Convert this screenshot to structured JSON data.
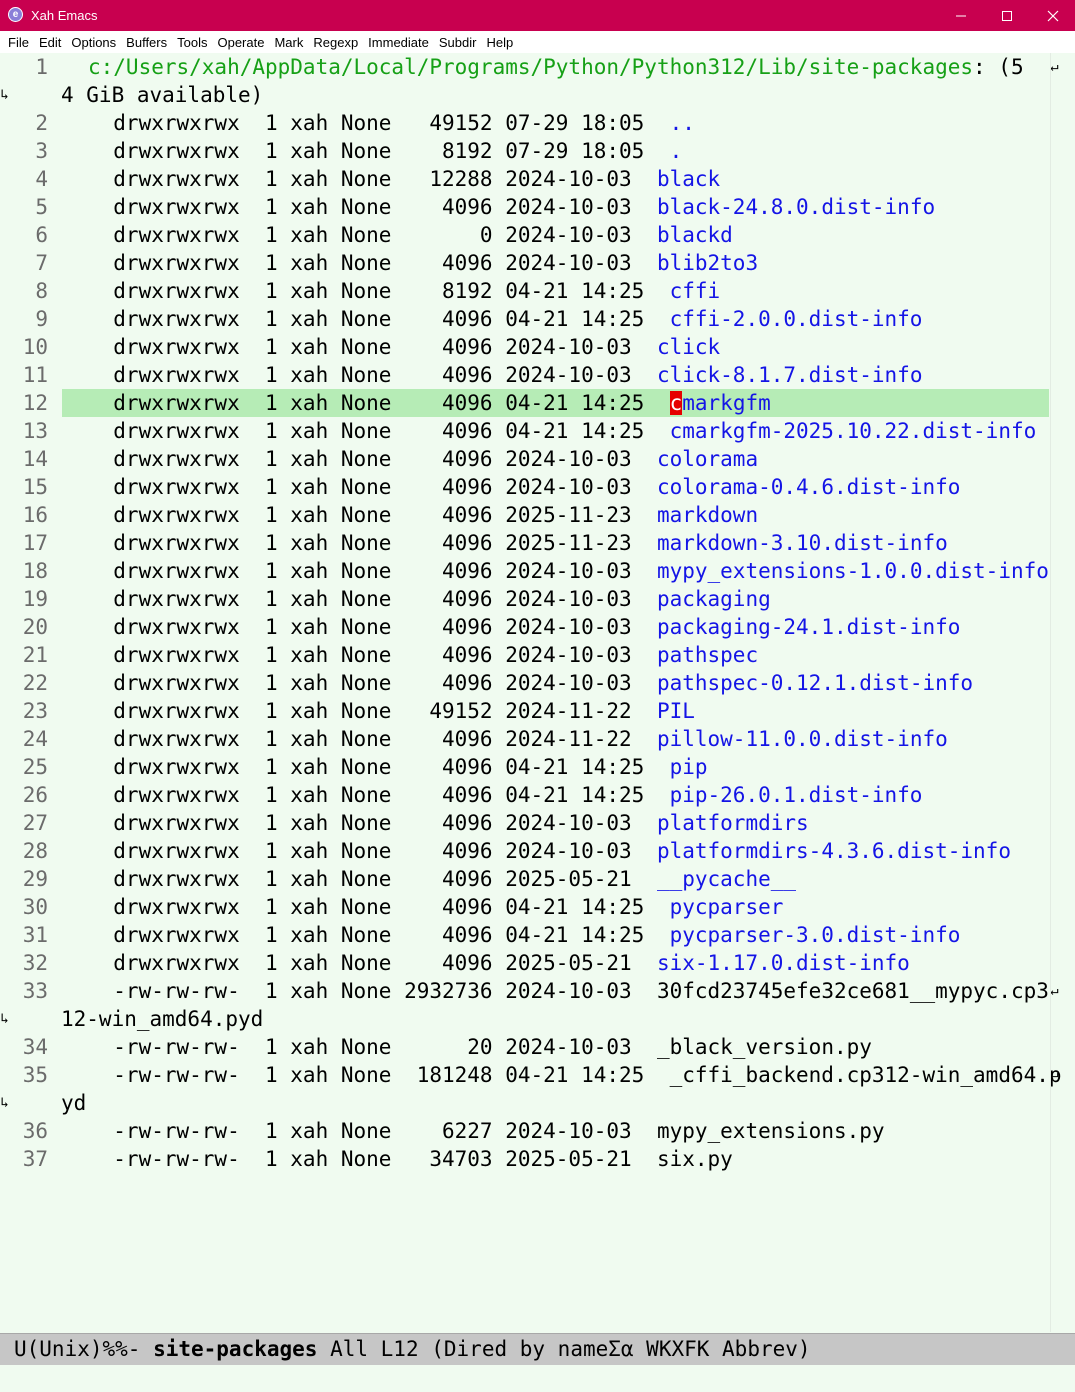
{
  "window": {
    "title": "Xah Emacs",
    "icon": "emacs-icon"
  },
  "menubar": {
    "items": [
      "File",
      "Edit",
      "Options",
      "Buffers",
      "Tools",
      "Operate",
      "Mark",
      "Regexp",
      "Immediate",
      "Subdir",
      "Help"
    ]
  },
  "colors": {
    "titlebar": "#c8004f",
    "directory": "#1414e6",
    "header_path": "#16a016",
    "highlight": "#b6ecb6",
    "cursor": "#e60000",
    "background": "#f0fbf0"
  },
  "buffer": {
    "header": {
      "line_number": "1",
      "path": "c:/Users/xah/AppData/Local/Programs/Python/Python312/Lib/site-packages",
      "rest": ": (5",
      "continuation": "4 GiB available)"
    },
    "entries": [
      {
        "n": "2",
        "attrs": "  drwxrwxrwx  1 xah None   49152 07-29 18:05  ",
        "name": "..",
        "dir": true
      },
      {
        "n": "3",
        "attrs": "  drwxrwxrwx  1 xah None    8192 07-29 18:05  ",
        "name": ".",
        "dir": true
      },
      {
        "n": "4",
        "attrs": "  drwxrwxrwx  1 xah None   12288 2024-10-03  ",
        "name": "black",
        "dir": true
      },
      {
        "n": "5",
        "attrs": "  drwxrwxrwx  1 xah None    4096 2024-10-03  ",
        "name": "black-24.8.0.dist-info",
        "dir": true
      },
      {
        "n": "6",
        "attrs": "  drwxrwxrwx  1 xah None       0 2024-10-03  ",
        "name": "blackd",
        "dir": true
      },
      {
        "n": "7",
        "attrs": "  drwxrwxrwx  1 xah None    4096 2024-10-03  ",
        "name": "blib2to3",
        "dir": true
      },
      {
        "n": "8",
        "attrs": "  drwxrwxrwx  1 xah None    8192 04-21 14:25  ",
        "name": "cffi",
        "dir": true
      },
      {
        "n": "9",
        "attrs": "  drwxrwxrwx  1 xah None    4096 04-21 14:25  ",
        "name": "cffi-2.0.0.dist-info",
        "dir": true
      },
      {
        "n": "10",
        "attrs": "  drwxrwxrwx  1 xah None    4096 2024-10-03  ",
        "name": "click",
        "dir": true
      },
      {
        "n": "11",
        "attrs": "  drwxrwxrwx  1 xah None    4096 2024-10-03  ",
        "name": "click-8.1.7.dist-info",
        "dir": true
      },
      {
        "n": "12",
        "attrs": "  drwxrwxrwx  1 xah None    4096 04-21 14:25  ",
        "name": "cmarkgfm",
        "dir": true,
        "current": true,
        "cursor_char": "c",
        "name_rest": "markgfm"
      },
      {
        "n": "13",
        "attrs": "  drwxrwxrwx  1 xah None    4096 04-21 14:25  ",
        "name": "cmarkgfm-2025.10.22.dist-info",
        "dir": true
      },
      {
        "n": "14",
        "attrs": "  drwxrwxrwx  1 xah None    4096 2024-10-03  ",
        "name": "colorama",
        "dir": true
      },
      {
        "n": "15",
        "attrs": "  drwxrwxrwx  1 xah None    4096 2024-10-03  ",
        "name": "colorama-0.4.6.dist-info",
        "dir": true
      },
      {
        "n": "16",
        "attrs": "  drwxrwxrwx  1 xah None    4096 2025-11-23  ",
        "name": "markdown",
        "dir": true
      },
      {
        "n": "17",
        "attrs": "  drwxrwxrwx  1 xah None    4096 2025-11-23  ",
        "name": "markdown-3.10.dist-info",
        "dir": true
      },
      {
        "n": "18",
        "attrs": "  drwxrwxrwx  1 xah None    4096 2024-10-03  ",
        "name": "mypy_extensions-1.0.0.dist-info",
        "dir": true
      },
      {
        "n": "19",
        "attrs": "  drwxrwxrwx  1 xah None    4096 2024-10-03  ",
        "name": "packaging",
        "dir": true
      },
      {
        "n": "20",
        "attrs": "  drwxrwxrwx  1 xah None    4096 2024-10-03  ",
        "name": "packaging-24.1.dist-info",
        "dir": true
      },
      {
        "n": "21",
        "attrs": "  drwxrwxrwx  1 xah None    4096 2024-10-03  ",
        "name": "pathspec",
        "dir": true
      },
      {
        "n": "22",
        "attrs": "  drwxrwxrwx  1 xah None    4096 2024-10-03  ",
        "name": "pathspec-0.12.1.dist-info",
        "dir": true
      },
      {
        "n": "23",
        "attrs": "  drwxrwxrwx  1 xah None   49152 2024-11-22  ",
        "name": "PIL",
        "dir": true
      },
      {
        "n": "24",
        "attrs": "  drwxrwxrwx  1 xah None    4096 2024-11-22  ",
        "name": "pillow-11.0.0.dist-info",
        "dir": true
      },
      {
        "n": "25",
        "attrs": "  drwxrwxrwx  1 xah None    4096 04-21 14:25  ",
        "name": "pip",
        "dir": true
      },
      {
        "n": "26",
        "attrs": "  drwxrwxrwx  1 xah None    4096 04-21 14:25  ",
        "name": "pip-26.0.1.dist-info",
        "dir": true
      },
      {
        "n": "27",
        "attrs": "  drwxrwxrwx  1 xah None    4096 2024-10-03  ",
        "name": "platformdirs",
        "dir": true
      },
      {
        "n": "28",
        "attrs": "  drwxrwxrwx  1 xah None    4096 2024-10-03  ",
        "name": "platformdirs-4.3.6.dist-info",
        "dir": true
      },
      {
        "n": "29",
        "attrs": "  drwxrwxrwx  1 xah None    4096 2025-05-21  ",
        "name": "__pycache__",
        "dir": true
      },
      {
        "n": "30",
        "attrs": "  drwxrwxrwx  1 xah None    4096 04-21 14:25  ",
        "name": "pycparser",
        "dir": true
      },
      {
        "n": "31",
        "attrs": "  drwxrwxrwx  1 xah None    4096 04-21 14:25  ",
        "name": "pycparser-3.0.dist-info",
        "dir": true
      },
      {
        "n": "32",
        "attrs": "  drwxrwxrwx  1 xah None    4096 2025-05-21  ",
        "name": "six-1.17.0.dist-info",
        "dir": true
      },
      {
        "n": "33",
        "attrs": "  -rw-rw-rw-  1 xah None 2932736 2024-10-03  ",
        "name": "30fcd23745efe32ce681__mypyc.cp3",
        "dir": false,
        "continuation": "12-win_amd64.pyd"
      },
      {
        "n": "34",
        "attrs": "  -rw-rw-rw-  1 xah None      20 2024-10-03  ",
        "name": "_black_version.py",
        "dir": false
      },
      {
        "n": "35",
        "attrs": "  -rw-rw-rw-  1 xah None  181248 04-21 14:25  ",
        "name": "_cffi_backend.cp312-win_amd64.p",
        "dir": false,
        "continuation": "yd"
      },
      {
        "n": "36",
        "attrs": "  -rw-rw-rw-  1 xah None    6227 2024-10-03  ",
        "name": "mypy_extensions.py",
        "dir": false
      },
      {
        "n": "37",
        "attrs": "  -rw-rw-rw-  1 xah None   34703 2025-05-21  ",
        "name": "six.py",
        "dir": false
      }
    ]
  },
  "modeline": {
    "prefix": "U(Unix)%%- ",
    "buffer_name": "site-packages",
    "rest": " All L12 (Dired by nameΣα WKXFK Abbrev)"
  }
}
